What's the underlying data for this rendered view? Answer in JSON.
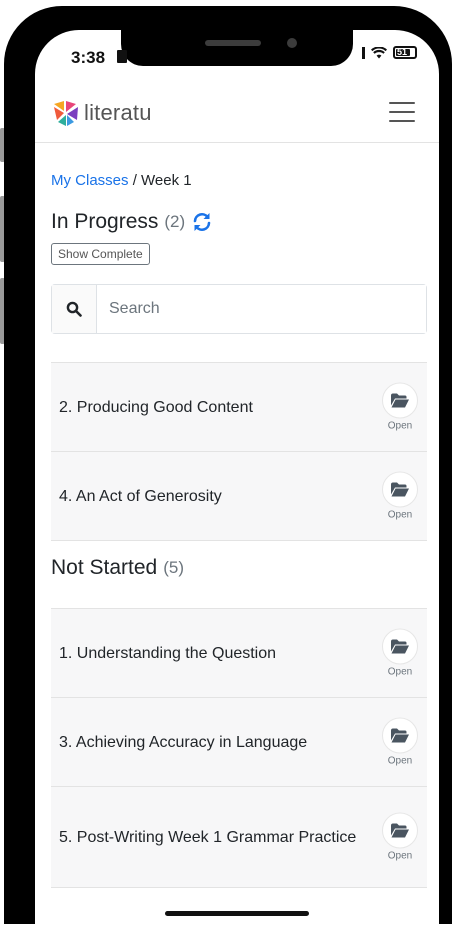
{
  "status_bar": {
    "time": "3:38",
    "battery": "51"
  },
  "brand": {
    "name": "literatu"
  },
  "breadcrumb": {
    "parent": "My Classes",
    "separator": "/",
    "current": "Week 1"
  },
  "in_progress": {
    "title": "In Progress",
    "count": "(2)",
    "show_complete_label": "Show Complete",
    "items": [
      {
        "label": "2. Producing Good Content",
        "action": "Open"
      },
      {
        "label": "4. An Act of Generosity",
        "action": "Open"
      }
    ]
  },
  "search": {
    "placeholder": "Search",
    "value": ""
  },
  "not_started": {
    "title": "Not Started",
    "count": "(5)",
    "items": [
      {
        "label": "1. Understanding the Question",
        "action": "Open"
      },
      {
        "label": "3. Achieving Accuracy in Language",
        "action": "Open"
      },
      {
        "label": "5. Post-Writing Week 1 Grammar Practice",
        "action": "Open"
      }
    ]
  },
  "icons": {
    "search": "search-icon",
    "refresh": "refresh-icon",
    "open": "folder-open-icon",
    "menu": "hamburger-menu-icon"
  },
  "colors": {
    "link": "#1a73e8",
    "refresh": "#1a73e8",
    "folder": "#4a5560"
  }
}
